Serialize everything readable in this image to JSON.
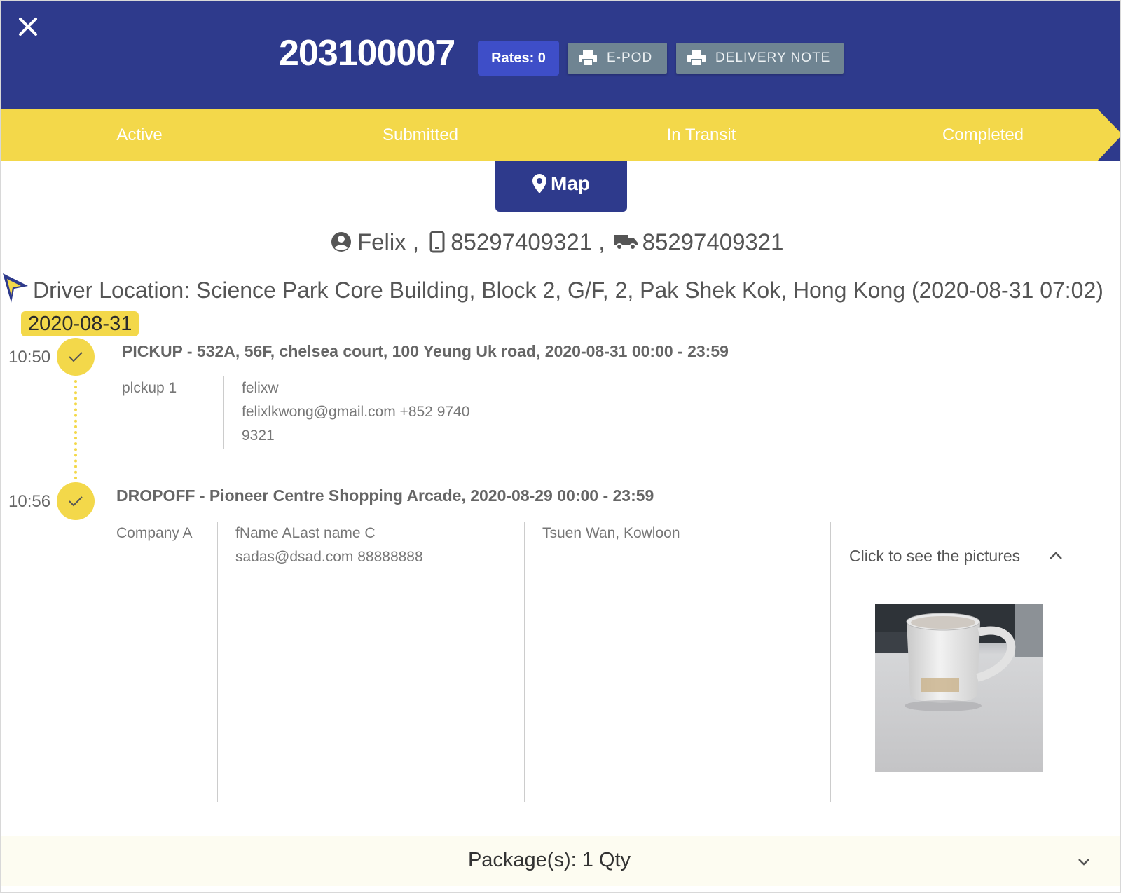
{
  "header": {
    "close_icon": "close-icon",
    "job_number": "203100007",
    "rates_label": "Rates: 0",
    "epod_label": "E-POD",
    "delivery_note_label": "DELIVERY NOTE",
    "bg_color": "#2e3a8c"
  },
  "status_steps": [
    {
      "label": "Active"
    },
    {
      "label": "Submitted"
    },
    {
      "label": "In Transit"
    },
    {
      "label": "Completed"
    }
  ],
  "status_color": "#f3d84a",
  "map_button": {
    "label": "Map",
    "icon": "map-pin-icon"
  },
  "driver": {
    "name": "Felix",
    "sep1": ",",
    "phone": "85297409321",
    "sep2": ",",
    "vehicle": "85297409321"
  },
  "driver_location": {
    "text": "Driver Location: Science Park Core Building, Block 2, G/F, 2, Pak Shek Kok, Hong Kong (2020-08-31 07:02)"
  },
  "date_chip": "2020-08-31",
  "stops": [
    {
      "time": "10:50",
      "title": "PICKUP - 532A, 56F, chelsea court, 100 Yeung Uk road, 2020-08-31 00:00 - 23:59",
      "company": "plckup 1",
      "contact_name": "felixw",
      "contact_line2": "felixlkwong@gmail.com +852 9740",
      "contact_line3": "9321"
    },
    {
      "time": "10:56",
      "title": "DROPOFF - Pioneer Centre Shopping Arcade, 2020-08-29 00:00 - 23:59",
      "company": "Company A",
      "contact_name": "fName ALast name C",
      "contact_line2": "sadas@dsad.com 88888888",
      "area": "Tsuen Wan, Kowloon",
      "pictures_label": "Click to see the pictures"
    }
  ],
  "packages": {
    "label": "Package(s): 1 Qty"
  }
}
